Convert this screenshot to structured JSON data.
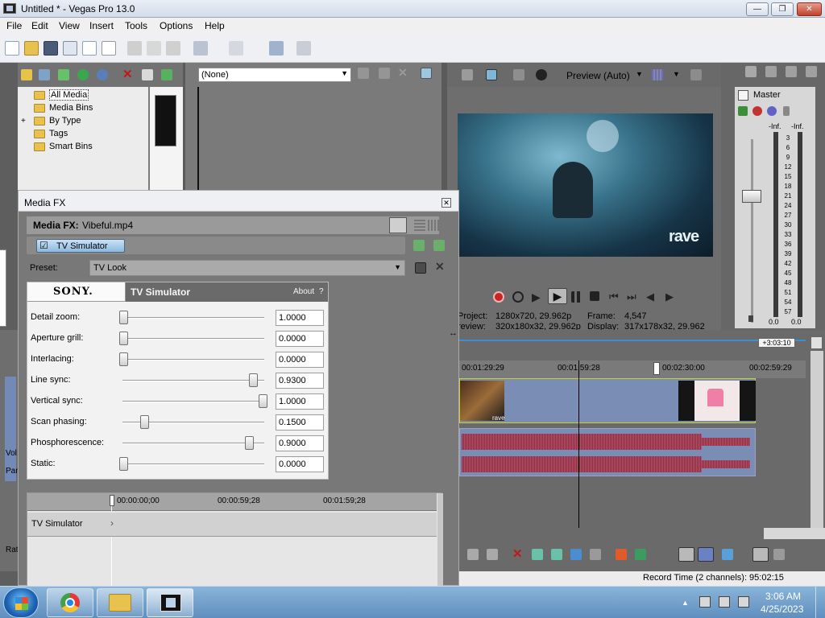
{
  "window": {
    "title": "Untitled * - Vegas Pro 13.0"
  },
  "menu": [
    "File",
    "Edit",
    "View",
    "Insert",
    "Tools",
    "Options",
    "Help"
  ],
  "explorer": {
    "items": [
      {
        "label": "All Media",
        "selected": true
      },
      {
        "label": "Media Bins"
      },
      {
        "label": "By Type",
        "expander": "+"
      },
      {
        "label": "Tags"
      },
      {
        "label": "Smart Bins"
      }
    ],
    "filter": "(None)"
  },
  "preview": {
    "mode": "Preview (Auto)",
    "watermark": "rave",
    "project_label": "Project:",
    "project_value": "1280x720, 29.962p",
    "preview_label": "review:",
    "preview_value": "320x180x32, 29.962p",
    "frame_label": "Frame:",
    "frame_value": "4,547",
    "display_label": "Display:",
    "display_value": "317x178x32, 29.962"
  },
  "mixer": {
    "title": "Master",
    "peak_left": "-Inf.",
    "peak_right": "-Inf.",
    "scale": [
      "3",
      "6",
      "9",
      "12",
      "15",
      "18",
      "21",
      "24",
      "27",
      "30",
      "33",
      "36",
      "39",
      "42",
      "45",
      "48",
      "51",
      "54",
      "57"
    ],
    "level_left": "0.0",
    "level_right": "0.0"
  },
  "timeline": {
    "length_badge": "+3:03:10",
    "ruler": [
      "00:01:29:29",
      "00:01:59:28",
      "00:02:30:00",
      "00:02:59:29"
    ],
    "track_label_vol": "Vol",
    "track_label_pan": "Pan",
    "track_label_rate": "Rat",
    "clip_watermark": "rave",
    "record_time": "Record Time (2 channels): 95:02:15"
  },
  "media_fx": {
    "window_title": "Media FX",
    "header_label": "Media FX:",
    "header_file": "Vibeful.mp4",
    "chain_item": "TV Simulator",
    "preset_label": "Preset:",
    "preset_value": "TV Look",
    "brand": "SONY.",
    "plugin_title": "TV Simulator",
    "about": "About",
    "about_help": "?",
    "params": [
      {
        "label": "Detail zoom:",
        "value": "1.0000",
        "level": 0.0
      },
      {
        "label": "Aperture grill:",
        "value": "0.0000",
        "level": 0.0
      },
      {
        "label": "Interlacing:",
        "value": "0.0000",
        "level": 0.0
      },
      {
        "label": "Line sync:",
        "value": "0.9300",
        "level": 0.93
      },
      {
        "label": "Vertical sync:",
        "value": "1.0000",
        "level": 1.0
      },
      {
        "label": "Scan phasing:",
        "value": "0.1500",
        "level": 0.15
      },
      {
        "label": "Phosphorescence:",
        "value": "0.9000",
        "level": 0.9
      },
      {
        "label": "Static:",
        "value": "0.0000",
        "level": 0.0
      }
    ],
    "kf_ruler": [
      "00:00:00;00",
      "00:00:59;28",
      "00:01:59;28"
    ],
    "kf_track": "TV Simulator"
  },
  "taskbar": {
    "time": "3:06 AM",
    "date": "4/25/2023"
  }
}
